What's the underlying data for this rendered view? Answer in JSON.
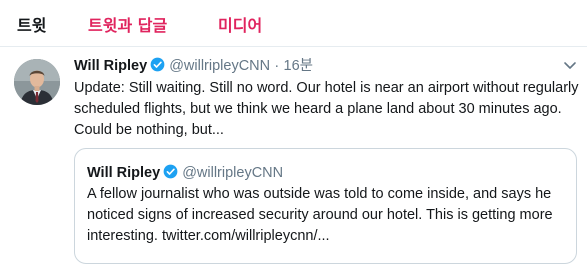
{
  "tabs": [
    "트윗",
    "트윗과 답글",
    "미디어"
  ],
  "tweet": {
    "name": "Will Ripley",
    "handle": "@willripleyCNN",
    "separator": "·",
    "time": "16분",
    "text": "Update: Still waiting. Still no word. Our hotel is near an airport without regularly scheduled flights, but we think we heard a plane land about 30 minutes ago. Could be nothing, but..."
  },
  "quote": {
    "name": "Will Ripley",
    "handle": "@willripleyCNN",
    "text": "A fellow journalist who was outside was told to come inside, and says he noticed signs of increased security around our hotel. This is getting more interesting. twitter.com/willripleycnn/..."
  },
  "icons": {
    "verified": "verified-badge-icon",
    "menu": "chevron-down-icon"
  },
  "colors": {
    "accent": "#e0245e",
    "verified": "#1da1f2",
    "muted": "#657786",
    "border": "#ccd6dd"
  }
}
